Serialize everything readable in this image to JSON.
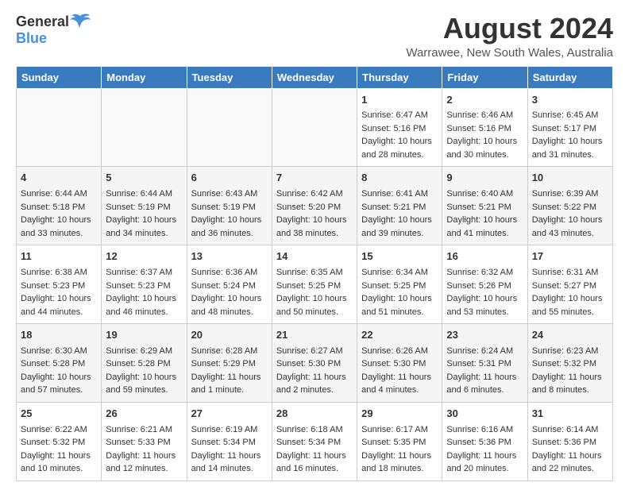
{
  "header": {
    "logo_general": "General",
    "logo_blue": "Blue",
    "title": "August 2024",
    "subtitle": "Warrawee, New South Wales, Australia"
  },
  "calendar": {
    "days_of_week": [
      "Sunday",
      "Monday",
      "Tuesday",
      "Wednesday",
      "Thursday",
      "Friday",
      "Saturday"
    ],
    "weeks": [
      [
        {
          "day": "",
          "details": ""
        },
        {
          "day": "",
          "details": ""
        },
        {
          "day": "",
          "details": ""
        },
        {
          "day": "",
          "details": ""
        },
        {
          "day": "1",
          "details": "Sunrise: 6:47 AM\nSunset: 5:16 PM\nDaylight: 10 hours\nand 28 minutes."
        },
        {
          "day": "2",
          "details": "Sunrise: 6:46 AM\nSunset: 5:16 PM\nDaylight: 10 hours\nand 30 minutes."
        },
        {
          "day": "3",
          "details": "Sunrise: 6:45 AM\nSunset: 5:17 PM\nDaylight: 10 hours\nand 31 minutes."
        }
      ],
      [
        {
          "day": "4",
          "details": "Sunrise: 6:44 AM\nSunset: 5:18 PM\nDaylight: 10 hours\nand 33 minutes."
        },
        {
          "day": "5",
          "details": "Sunrise: 6:44 AM\nSunset: 5:19 PM\nDaylight: 10 hours\nand 34 minutes."
        },
        {
          "day": "6",
          "details": "Sunrise: 6:43 AM\nSunset: 5:19 PM\nDaylight: 10 hours\nand 36 minutes."
        },
        {
          "day": "7",
          "details": "Sunrise: 6:42 AM\nSunset: 5:20 PM\nDaylight: 10 hours\nand 38 minutes."
        },
        {
          "day": "8",
          "details": "Sunrise: 6:41 AM\nSunset: 5:21 PM\nDaylight: 10 hours\nand 39 minutes."
        },
        {
          "day": "9",
          "details": "Sunrise: 6:40 AM\nSunset: 5:21 PM\nDaylight: 10 hours\nand 41 minutes."
        },
        {
          "day": "10",
          "details": "Sunrise: 6:39 AM\nSunset: 5:22 PM\nDaylight: 10 hours\nand 43 minutes."
        }
      ],
      [
        {
          "day": "11",
          "details": "Sunrise: 6:38 AM\nSunset: 5:23 PM\nDaylight: 10 hours\nand 44 minutes."
        },
        {
          "day": "12",
          "details": "Sunrise: 6:37 AM\nSunset: 5:23 PM\nDaylight: 10 hours\nand 46 minutes."
        },
        {
          "day": "13",
          "details": "Sunrise: 6:36 AM\nSunset: 5:24 PM\nDaylight: 10 hours\nand 48 minutes."
        },
        {
          "day": "14",
          "details": "Sunrise: 6:35 AM\nSunset: 5:25 PM\nDaylight: 10 hours\nand 50 minutes."
        },
        {
          "day": "15",
          "details": "Sunrise: 6:34 AM\nSunset: 5:25 PM\nDaylight: 10 hours\nand 51 minutes."
        },
        {
          "day": "16",
          "details": "Sunrise: 6:32 AM\nSunset: 5:26 PM\nDaylight: 10 hours\nand 53 minutes."
        },
        {
          "day": "17",
          "details": "Sunrise: 6:31 AM\nSunset: 5:27 PM\nDaylight: 10 hours\nand 55 minutes."
        }
      ],
      [
        {
          "day": "18",
          "details": "Sunrise: 6:30 AM\nSunset: 5:28 PM\nDaylight: 10 hours\nand 57 minutes."
        },
        {
          "day": "19",
          "details": "Sunrise: 6:29 AM\nSunset: 5:28 PM\nDaylight: 10 hours\nand 59 minutes."
        },
        {
          "day": "20",
          "details": "Sunrise: 6:28 AM\nSunset: 5:29 PM\nDaylight: 11 hours\nand 1 minute."
        },
        {
          "day": "21",
          "details": "Sunrise: 6:27 AM\nSunset: 5:30 PM\nDaylight: 11 hours\nand 2 minutes."
        },
        {
          "day": "22",
          "details": "Sunrise: 6:26 AM\nSunset: 5:30 PM\nDaylight: 11 hours\nand 4 minutes."
        },
        {
          "day": "23",
          "details": "Sunrise: 6:24 AM\nSunset: 5:31 PM\nDaylight: 11 hours\nand 6 minutes."
        },
        {
          "day": "24",
          "details": "Sunrise: 6:23 AM\nSunset: 5:32 PM\nDaylight: 11 hours\nand 8 minutes."
        }
      ],
      [
        {
          "day": "25",
          "details": "Sunrise: 6:22 AM\nSunset: 5:32 PM\nDaylight: 11 hours\nand 10 minutes."
        },
        {
          "day": "26",
          "details": "Sunrise: 6:21 AM\nSunset: 5:33 PM\nDaylight: 11 hours\nand 12 minutes."
        },
        {
          "day": "27",
          "details": "Sunrise: 6:19 AM\nSunset: 5:34 PM\nDaylight: 11 hours\nand 14 minutes."
        },
        {
          "day": "28",
          "details": "Sunrise: 6:18 AM\nSunset: 5:34 PM\nDaylight: 11 hours\nand 16 minutes."
        },
        {
          "day": "29",
          "details": "Sunrise: 6:17 AM\nSunset: 5:35 PM\nDaylight: 11 hours\nand 18 minutes."
        },
        {
          "day": "30",
          "details": "Sunrise: 6:16 AM\nSunset: 5:36 PM\nDaylight: 11 hours\nand 20 minutes."
        },
        {
          "day": "31",
          "details": "Sunrise: 6:14 AM\nSunset: 5:36 PM\nDaylight: 11 hours\nand 22 minutes."
        }
      ]
    ]
  }
}
